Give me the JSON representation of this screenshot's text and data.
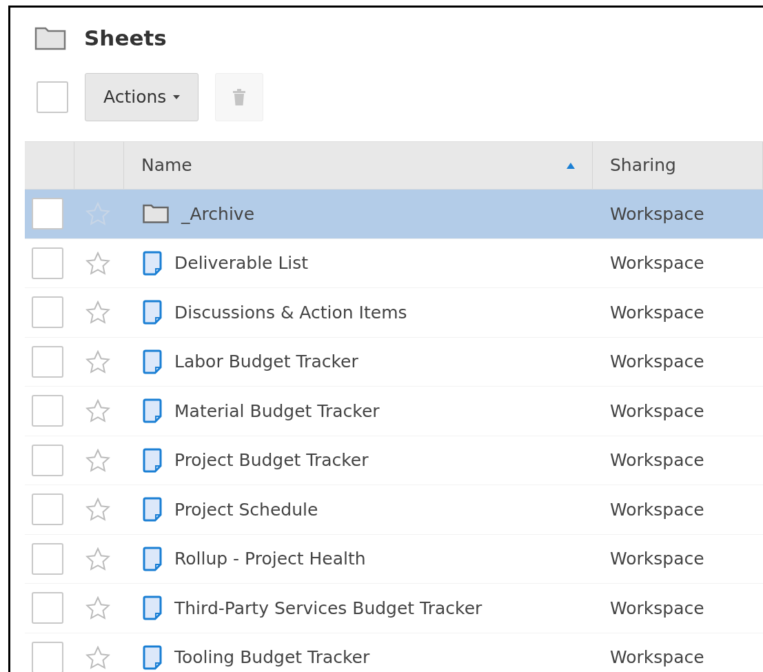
{
  "title": "Sheets",
  "toolbar": {
    "select_all": {
      "checked": false
    },
    "actions_label": "Actions",
    "delete": {
      "disabled": true
    }
  },
  "table": {
    "columns": [
      {
        "label": "Name",
        "sorted": true
      },
      {
        "label": "Sharing",
        "sorted": false
      }
    ],
    "rows": [
      {
        "kind": "folder",
        "name": "_Archive",
        "sharing": "Workspace",
        "selected": true,
        "checked": false,
        "starred": false
      },
      {
        "kind": "sheet",
        "name": "Deliverable List",
        "sharing": "Workspace",
        "selected": false,
        "checked": false,
        "starred": false
      },
      {
        "kind": "sheet",
        "name": "Discussions & Action Items",
        "sharing": "Workspace",
        "selected": false,
        "checked": false,
        "starred": false
      },
      {
        "kind": "sheet",
        "name": "Labor Budget Tracker",
        "sharing": "Workspace",
        "selected": false,
        "checked": false,
        "starred": false
      },
      {
        "kind": "sheet",
        "name": "Material Budget Tracker",
        "sharing": "Workspace",
        "selected": false,
        "checked": false,
        "starred": false
      },
      {
        "kind": "sheet",
        "name": "Project Budget Tracker",
        "sharing": "Workspace",
        "selected": false,
        "checked": false,
        "starred": false
      },
      {
        "kind": "sheet",
        "name": "Project Schedule",
        "sharing": "Workspace",
        "selected": false,
        "checked": false,
        "starred": false
      },
      {
        "kind": "sheet",
        "name": "Rollup - Project Health",
        "sharing": "Workspace",
        "selected": false,
        "checked": false,
        "starred": false
      },
      {
        "kind": "sheet",
        "name": "Third-Party Services Budget Tracker",
        "sharing": "Workspace",
        "selected": false,
        "checked": false,
        "starred": false
      },
      {
        "kind": "sheet",
        "name": "Tooling Budget Tracker",
        "sharing": "Workspace",
        "selected": false,
        "checked": false,
        "starred": false
      }
    ]
  }
}
